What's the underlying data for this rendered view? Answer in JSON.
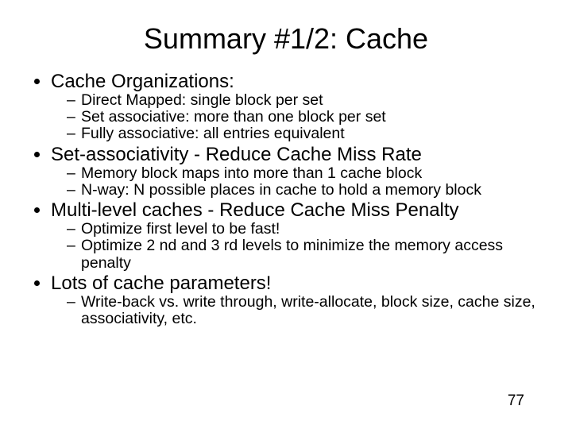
{
  "title": "Summary #1/2: Cache",
  "bullets": [
    {
      "text": "Cache Organizations:",
      "sub": [
        "Direct Mapped: single block per set",
        "Set associative: more than one block per set",
        "Fully associative: all entries equivalent"
      ]
    },
    {
      "text": "Set-associativity - Reduce Cache Miss Rate",
      "sub": [
        "Memory block maps into more than 1 cache block",
        "N-way: N possible places in cache to hold a memory block"
      ]
    },
    {
      "text": "Multi-level caches - Reduce Cache Miss Penalty",
      "sub": [
        "Optimize first level to be fast!",
        "Optimize 2 nd and 3 rd levels to minimize the memory access penalty"
      ]
    },
    {
      "text": "Lots of cache parameters!",
      "sub": [
        "Write-back vs. write through, write-allocate, block size, cache size, associativity, etc."
      ]
    }
  ],
  "page_number": "77"
}
